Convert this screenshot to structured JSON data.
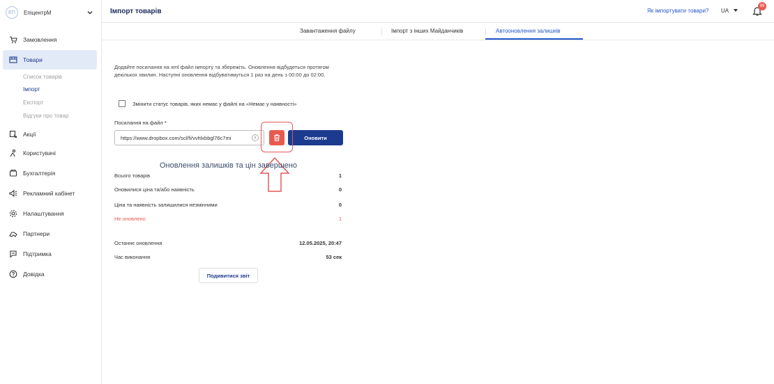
{
  "sidebar": {
    "brand_initials": "ЕП",
    "brand_name": "ЕпіцентрМ",
    "items": [
      {
        "label": "Замовлення",
        "icon": "cart-icon"
      },
      {
        "label": "Товари",
        "icon": "products-icon",
        "active": true
      },
      {
        "label": "Акції",
        "icon": "promo-icon"
      },
      {
        "label": "Користувачі",
        "icon": "users-icon"
      },
      {
        "label": "Бухгалтерія",
        "icon": "wallet-icon"
      },
      {
        "label": "Рекламний кабінет",
        "icon": "megaphone-icon"
      },
      {
        "label": "Налаштування",
        "icon": "gear-icon"
      },
      {
        "label": "Партнери",
        "icon": "handshake-icon"
      },
      {
        "label": "Підтримка",
        "icon": "chat-icon"
      },
      {
        "label": "Довідка",
        "icon": "help-icon"
      }
    ],
    "subitems": [
      "Список товарів",
      "Імпорт",
      "Експорт",
      "Відгуки про товар"
    ]
  },
  "header": {
    "title": "Імпорт товарів",
    "help_link": "Як імпортувати товари?",
    "lang": "UA",
    "notifications_count": "99"
  },
  "tabs": [
    {
      "label": "Завантаження файлу"
    },
    {
      "label": "Імпорт з інших Майданчиків"
    },
    {
      "label": "Автооновлення залишків",
      "active": true
    }
  ],
  "form": {
    "description": "Додайте посилання на xml файл імпорту та збережіть. Оновлення відбудеться протягом декількох хвилин. Наступні оновлення відбуватимуться 1 раз на день з 00:00 до 02:00.",
    "checkbox_label": "Змінити статус товарів, яких немає у файлі на «Немає у наявності»",
    "checkbox_checked": false,
    "url_label": "Посилання на файл *",
    "url_value": "https://www.dropbox.com/scl/fi/vvhlxbbgl76c7mi",
    "update_button": "Оновити"
  },
  "summary": {
    "title": "Оновлення залишків та цін завершено",
    "rows": [
      {
        "label": "Всього товарів",
        "value": "1"
      },
      {
        "label": "Оновилися ціна та/або наявність",
        "value": "0"
      },
      {
        "label": "Ціна та наявність залишилися незмінними",
        "value": "0"
      },
      {
        "label": "Не оновлено",
        "value": "1",
        "error": true
      }
    ],
    "last_update_label": "Останнє оновлення",
    "last_update_value": "12.05.2025, 20:47",
    "duration_label": "Час виконання",
    "duration_value": "53 сек",
    "report_button": "Подивитися звіт"
  },
  "colors": {
    "accent": "#1c3b8f",
    "link": "#2156c7",
    "danger": "#e85a4f",
    "active_bg": "#e3eaf7"
  }
}
